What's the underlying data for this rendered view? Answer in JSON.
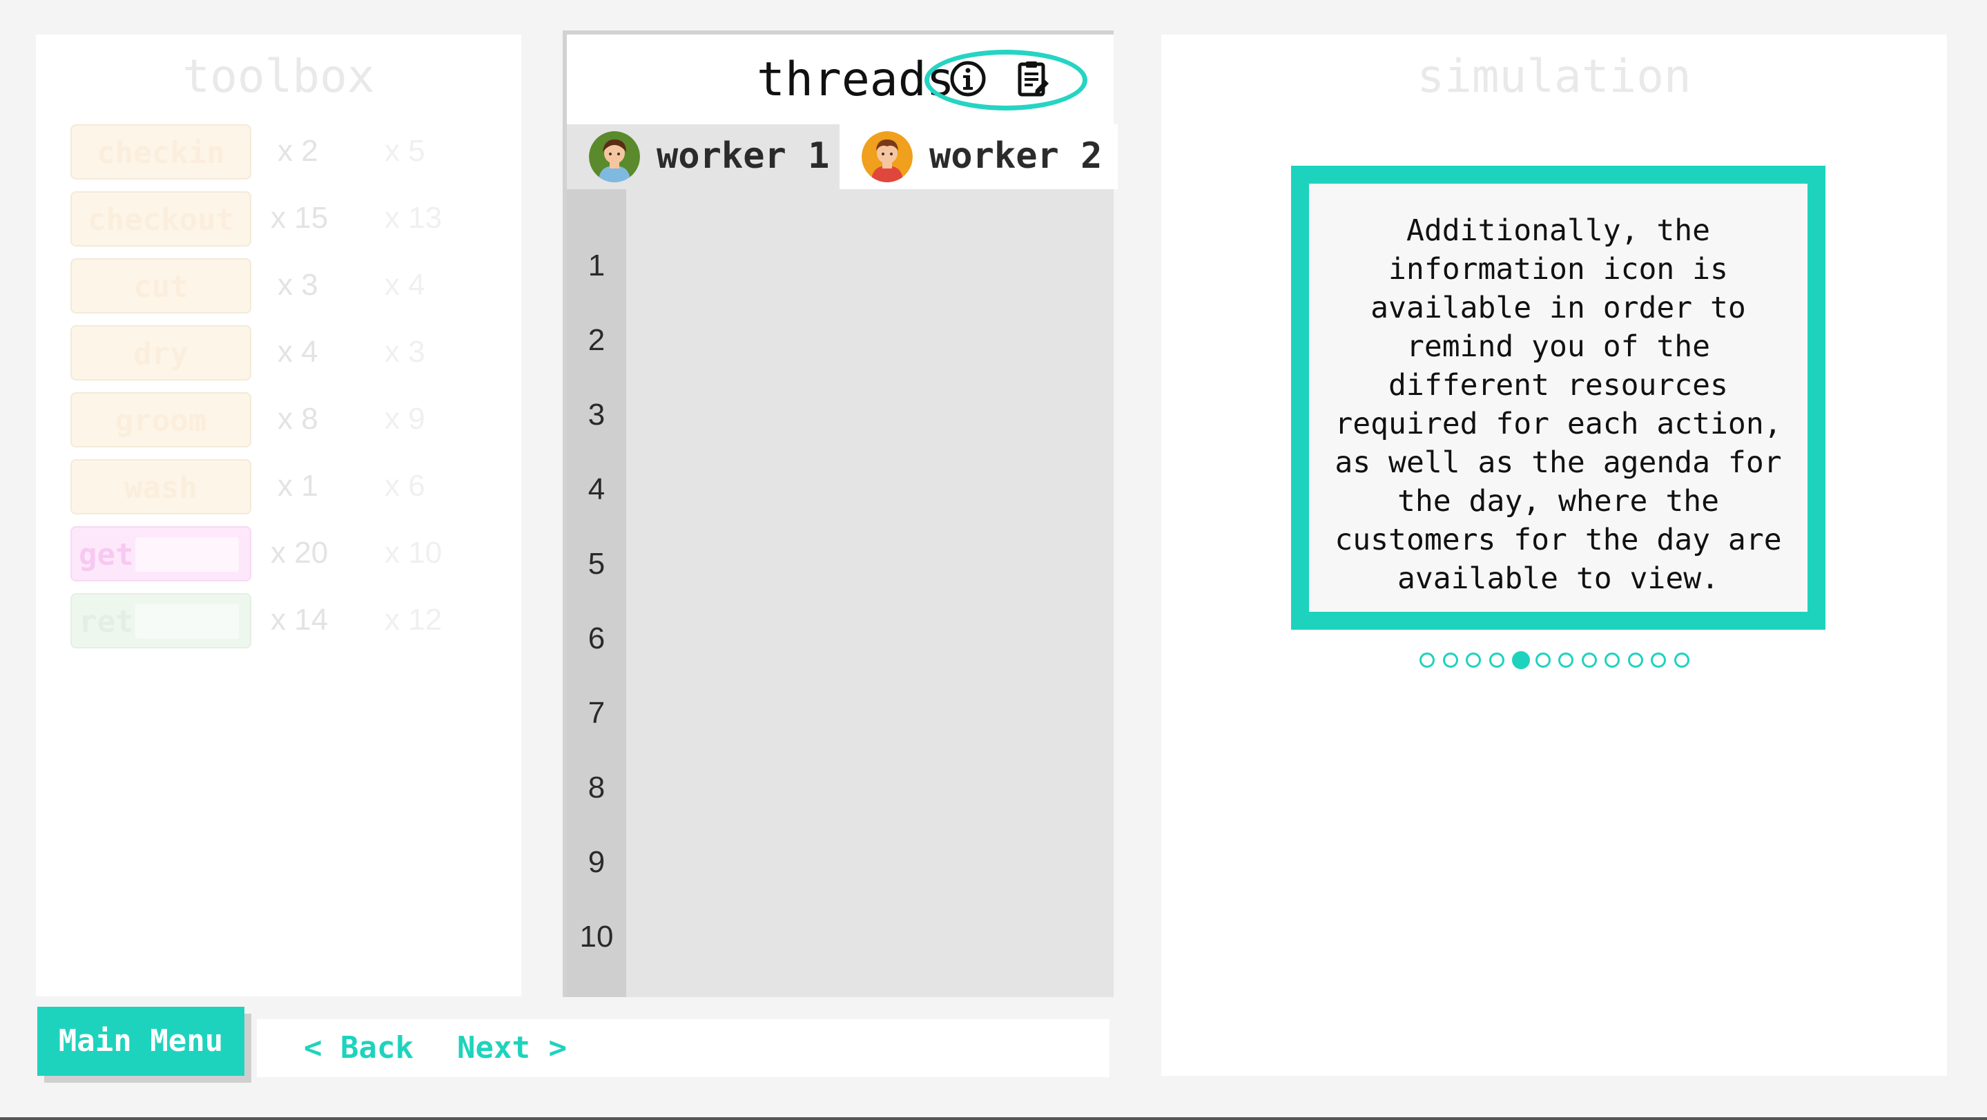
{
  "toolbox": {
    "title": "toolbox",
    "tools": [
      {
        "label": "checkin",
        "count": "x 2",
        "count2": "x 5",
        "kind": "action"
      },
      {
        "label": "checkout",
        "count": "x 15",
        "count2": "x 13",
        "kind": "action"
      },
      {
        "label": "cut",
        "count": "x 3",
        "count2": "x 4",
        "kind": "action"
      },
      {
        "label": "dry",
        "count": "x 4",
        "count2": "x 3",
        "kind": "action"
      },
      {
        "label": "groom",
        "count": "x 8",
        "count2": "x 9",
        "kind": "action"
      },
      {
        "label": "wash",
        "count": "x 1",
        "count2": "x 6",
        "kind": "action"
      },
      {
        "label": "get",
        "count": "x 20",
        "count2": "x 10",
        "kind": "get"
      },
      {
        "label": "ret",
        "count": "x 14",
        "count2": "x 12",
        "kind": "ret"
      }
    ]
  },
  "threads": {
    "title": "threads",
    "tabs": [
      {
        "label": "worker 1",
        "active": true
      },
      {
        "label": "worker 2",
        "active": false
      }
    ],
    "line_numbers": [
      "1",
      "2",
      "3",
      "4",
      "5",
      "6",
      "7",
      "8",
      "9",
      "10"
    ]
  },
  "simulation": {
    "title": "simulation",
    "tutorial_text": "Additionally, the information icon is available in order to remind you of the different resources required for each action, as well as the agenda for the day, where the customers for the day are available to view.",
    "page_count": 12,
    "current_page": 5
  },
  "nav": {
    "main_menu": "Main Menu",
    "back": "< Back",
    "next": "Next >"
  },
  "colors": {
    "accent": "#1ed3bd",
    "action_fill": "#fdf5e8",
    "get_fill": "#fde8fb",
    "ret_fill": "#eef7ee"
  }
}
